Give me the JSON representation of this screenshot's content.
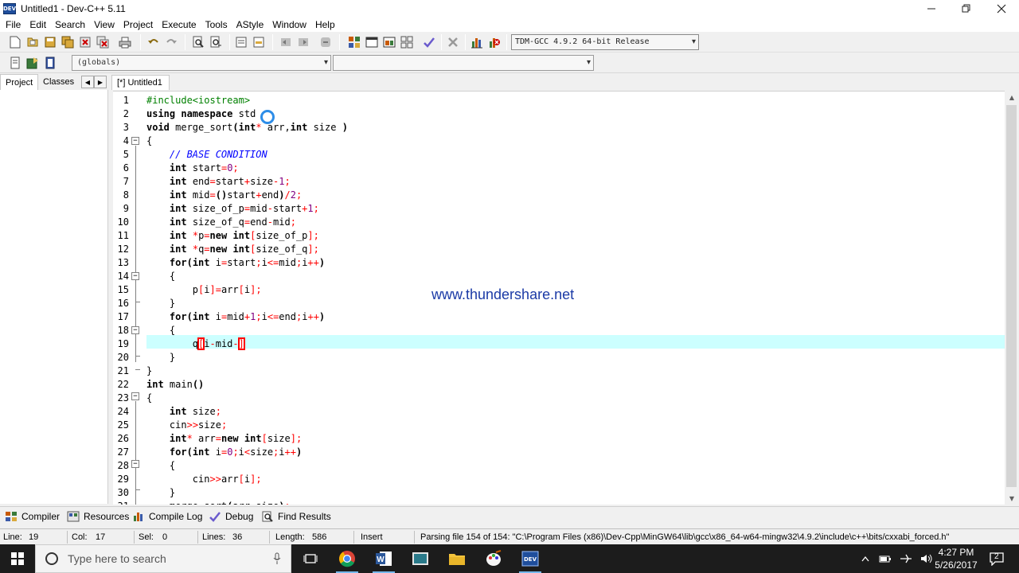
{
  "window": {
    "title": "Untitled1 - Dev-C++ 5.11",
    "app_icon_text": "DEV"
  },
  "menu": [
    "File",
    "Edit",
    "Search",
    "View",
    "Project",
    "Execute",
    "Tools",
    "AStyle",
    "Window",
    "Help"
  ],
  "toolbar": {
    "compiler": "TDM-GCC 4.9.2 64-bit Release"
  },
  "combos": {
    "scope": "(globals)",
    "symbol": ""
  },
  "left_tabs": [
    "Project",
    "Classes"
  ],
  "editor_tab": "[*] Untitled1",
  "code_lines": [
    "#include<iostream>",
    "using namespace std",
    "void merge_sort(int* arr,int size )",
    "{",
    "    // BASE CONDITION",
    "    int start=0;",
    "    int end=start+size-1;",
    "    int mid=()start+end)/2;",
    "    int size_of_p=mid-start+1;",
    "    int size_of_q=end-mid;",
    "    int *p=new int[size_of_p];",
    "    int *q=new int[size_of_q];",
    "    for(int i=start;i<=mid;i++)",
    "    {",
    "        p[i]=arr[i];",
    "    }",
    "    for(int i=mid+1;i<=end;i++)",
    "    {",
    "        q[i-mid-]",
    "    }",
    "}",
    "int main()",
    "{",
    "    int size;",
    "    cin>>size;",
    "    int* arr=new int[size];",
    "    for(int i=0;i<size;i++)",
    "    {",
    "        cin>>arr[i];",
    "    }",
    "    merge_sort(arr,size);"
  ],
  "watermark": "www.thundershare.net",
  "bottom_tabs": [
    "Compiler",
    "Resources",
    "Compile Log",
    "Debug",
    "Find Results"
  ],
  "status": {
    "line_label": "Line:",
    "line_value": "19",
    "col_label": "Col:",
    "col_value": "17",
    "sel_label": "Sel:",
    "sel_value": "0",
    "lines_label": "Lines:",
    "lines_value": "36",
    "length_label": "Length:",
    "length_value": "586",
    "mode": "Insert",
    "message": "Parsing file 154 of 154: \"C:\\Program Files (x86)\\Dev-Cpp\\MinGW64\\lib\\gcc\\x86_64-w64-mingw32\\4.9.2\\include\\c++\\bits/cxxabi_forced.h\""
  },
  "taskbar": {
    "search_placeholder": "Type here to search",
    "time": "4:27 PM",
    "date": "5/26/2017",
    "notification_count": "2"
  },
  "colors": {
    "keyword": "#000000",
    "preprocessor": "#008000",
    "comment": "#0000ff",
    "symbol": "#ff0000",
    "number": "#800080",
    "current_line": "#ccffff",
    "watermark": "#1b3aa6"
  }
}
